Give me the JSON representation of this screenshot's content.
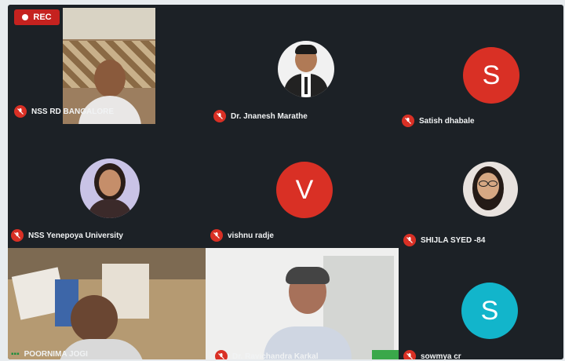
{
  "recording": {
    "label": "REC"
  },
  "participants": [
    {
      "name": "NSS RD BANGALORE",
      "type": "video"
    },
    {
      "name": "Dr. Jnanesh Marathe",
      "type": "photo"
    },
    {
      "name": "Satish dhabale",
      "type": "initial",
      "initial": "S",
      "color": "#d93025"
    },
    {
      "name": "NSS Yenepoya University",
      "type": "photo"
    },
    {
      "name": "vishnu radje",
      "type": "initial",
      "initial": "V",
      "color": "#d93025"
    },
    {
      "name": "SHIJLA SYED -84",
      "type": "photo"
    },
    {
      "name": "POORNIMA JOGI",
      "type": "video"
    },
    {
      "name": "Dr. Ravichandra Karkal",
      "type": "video"
    },
    {
      "name": "sowmya cr",
      "type": "initial",
      "initial": "S",
      "color": "#12b5cb"
    }
  ]
}
